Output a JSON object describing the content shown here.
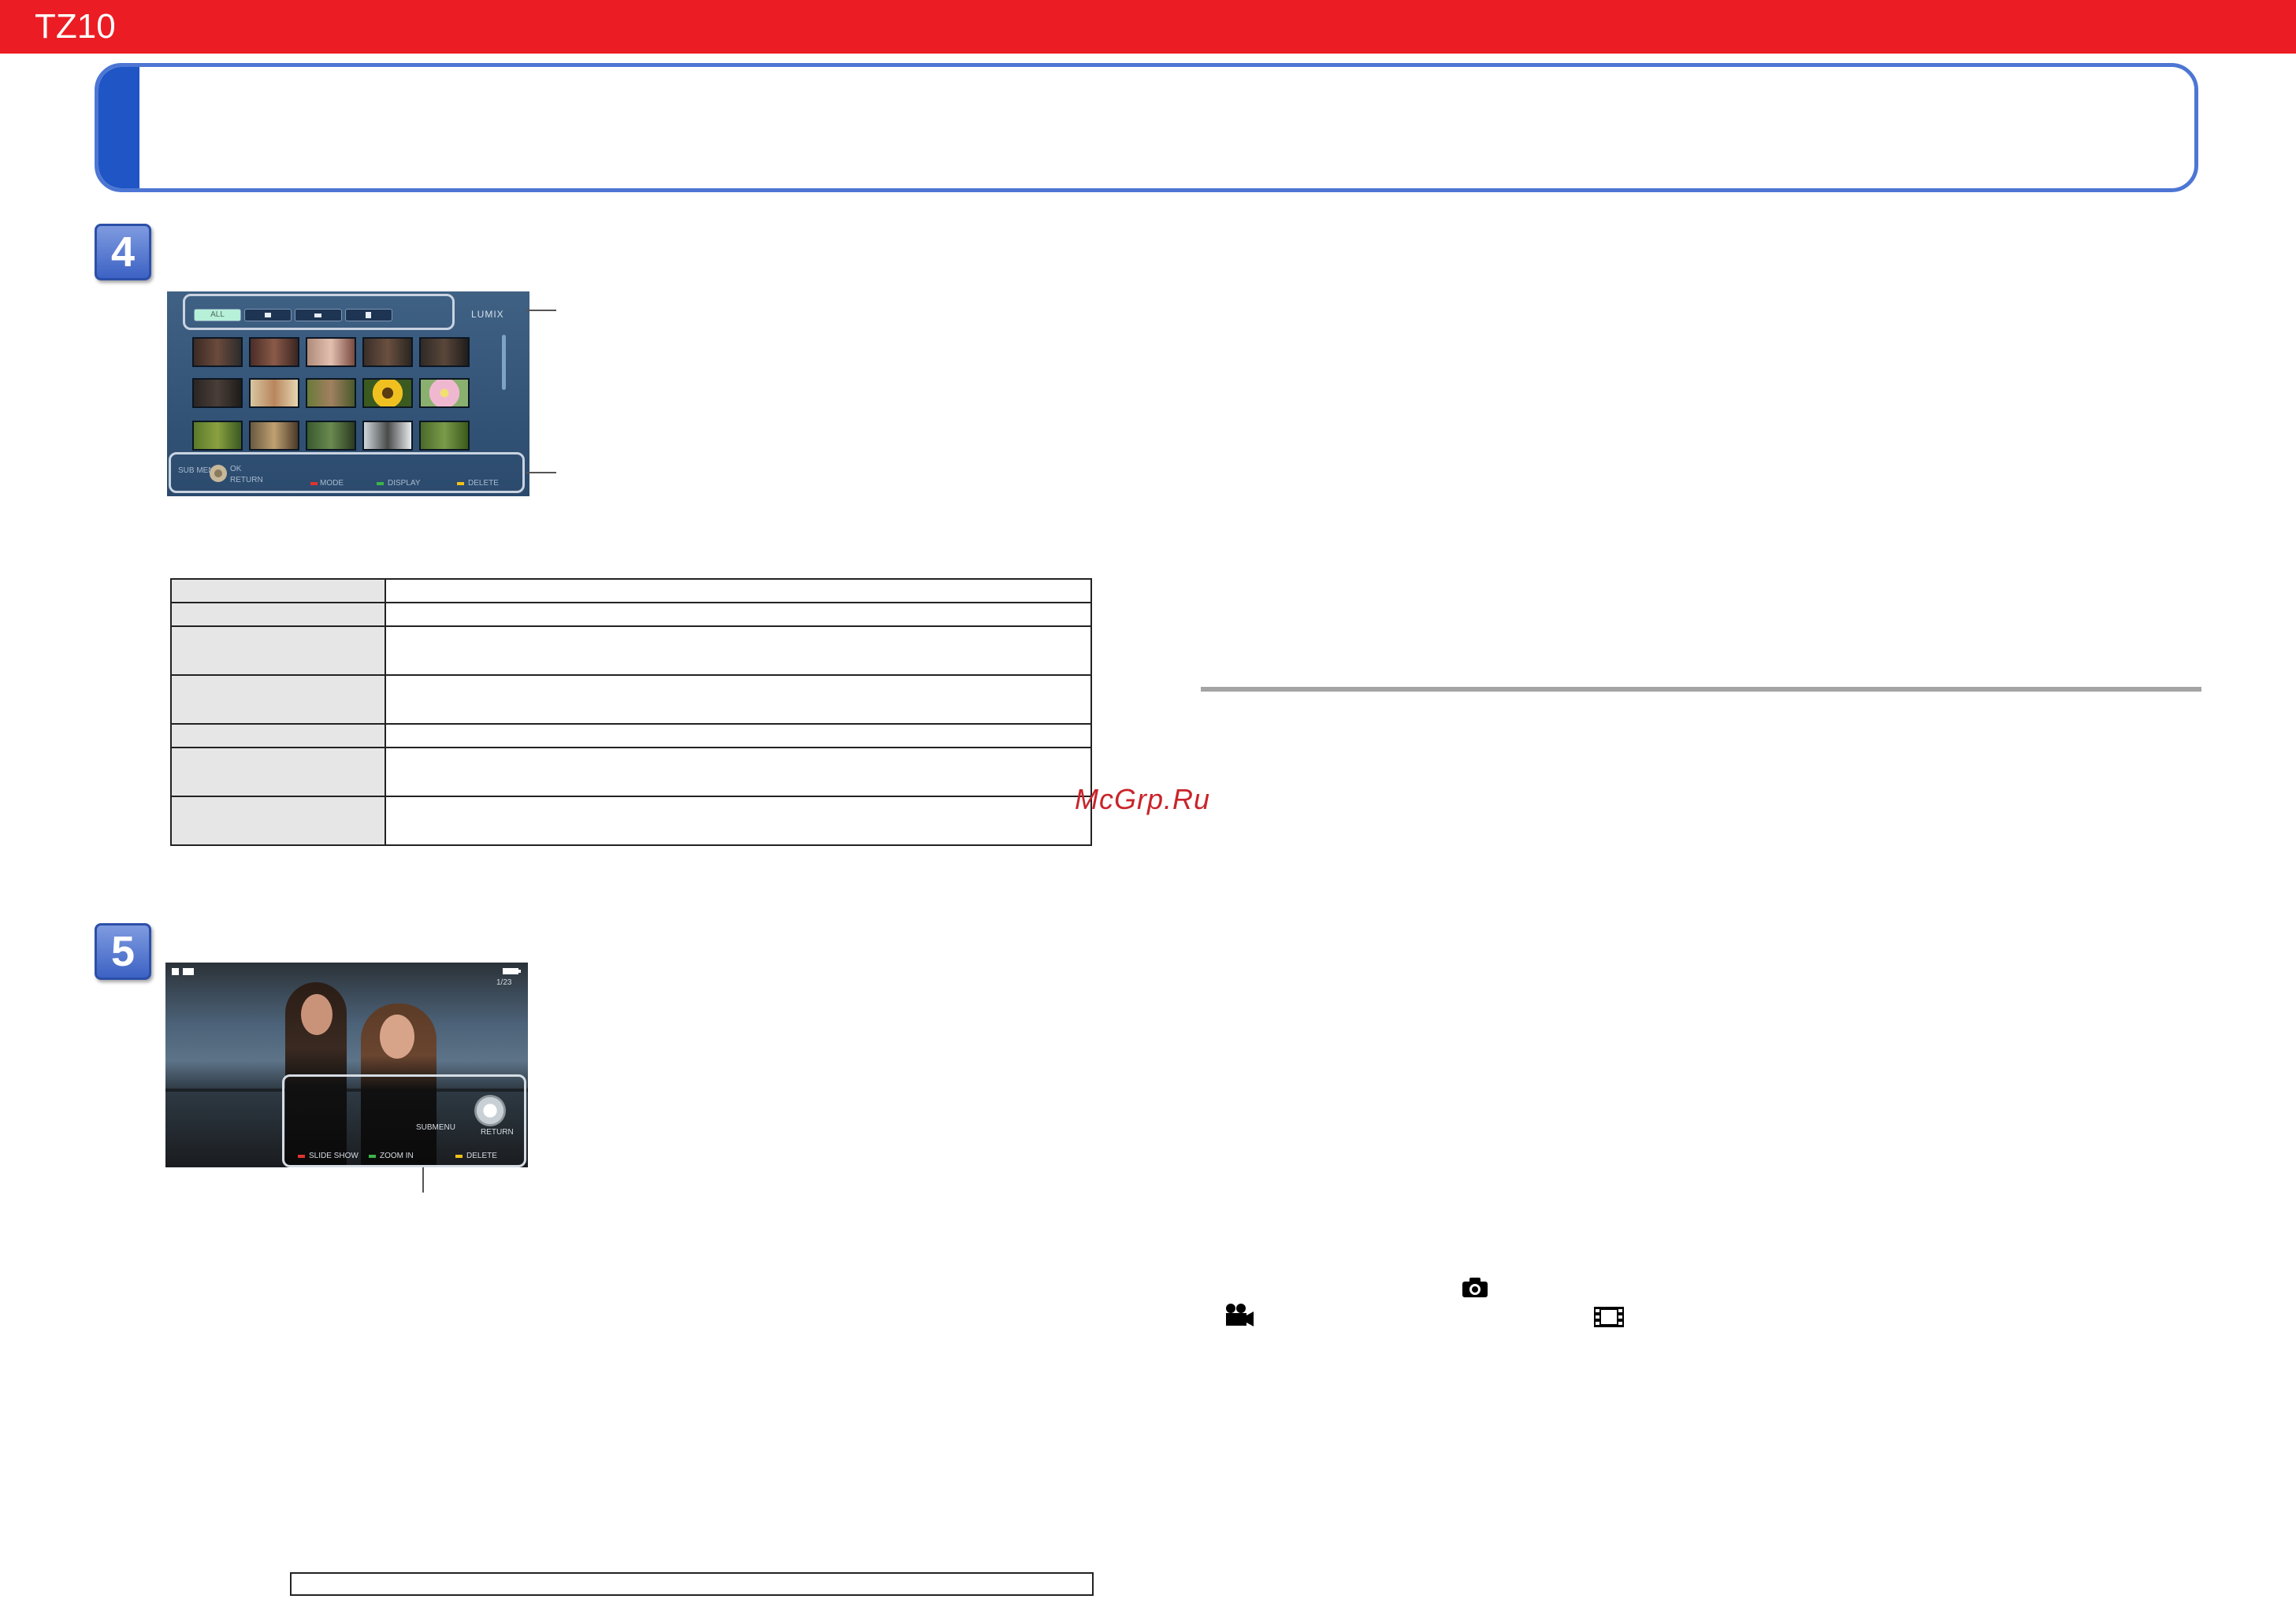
{
  "header": {
    "model": "TZ10",
    "color": "#ec1c24"
  },
  "steps": [
    {
      "number": "4"
    },
    {
      "number": "5"
    }
  ],
  "menu_screen": {
    "tabs": [
      "ALL",
      "camera-icon",
      "movie-camera-icon",
      "filmstrip-icon"
    ],
    "active_tab": "ALL",
    "brand": "LUMIX",
    "thumbnail_rows": 3,
    "thumbnail_columns": 5,
    "footer_hints": [
      "SUB MENU",
      "OK",
      "RETURN",
      "MODE",
      "DISPLAY",
      "DELETE"
    ],
    "footer_colors": [
      "#e0332e",
      "#3ab54a",
      "#f2c01a"
    ]
  },
  "playback_screen": {
    "counter": "1/23",
    "osd_hints": [
      "SLIDE SHOW",
      "ZOOM IN",
      "DELETE",
      "SUBMENU",
      "RETURN"
    ],
    "footer_colors": [
      "#e0332e",
      "#3ab54a",
      "#f2c01a"
    ]
  },
  "table_rows": 7,
  "watermark": "McGrp.Ru",
  "icons": [
    "camera-icon",
    "movie-camera-icon",
    "filmstrip-icon"
  ]
}
